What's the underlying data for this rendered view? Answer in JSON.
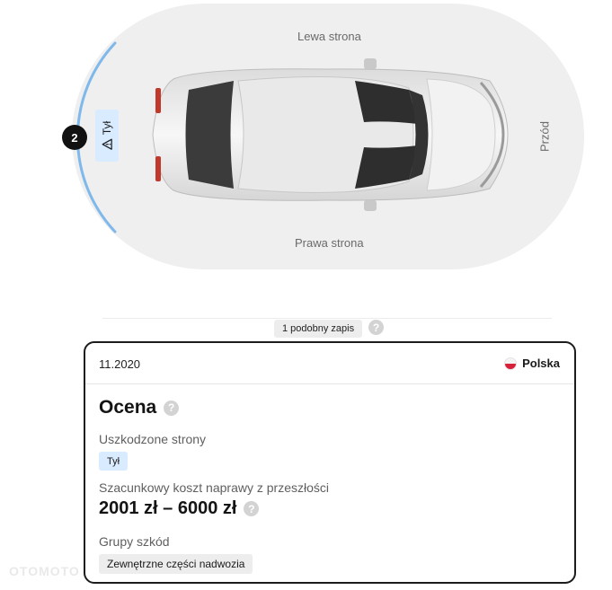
{
  "diagram": {
    "left_side_label": "Lewa strona",
    "right_side_label": "Prawa strona",
    "front_label": "Przód",
    "rear_tag_label": "Tył",
    "damage_count": "2",
    "warning_icon": "warning-triangle-icon",
    "highlight_color": "#7fb8ea"
  },
  "similar": {
    "label": "1 podobny zapis",
    "help_icon": "?"
  },
  "record": {
    "date": "11.2020",
    "country": "Polska",
    "rating_title": "Ocena",
    "help_icon": "?",
    "damaged_sides_label": "Uszkodzone strony",
    "damaged_sides": [
      "Tył"
    ],
    "cost_label": "Szacunkowy koszt naprawy z przeszłości",
    "cost_value": "2001 zł – 6000 zł",
    "groups_label": "Grupy szkód",
    "groups": [
      "Zewnętrzne części nadwozia"
    ]
  },
  "watermark": "OTOMOTO"
}
